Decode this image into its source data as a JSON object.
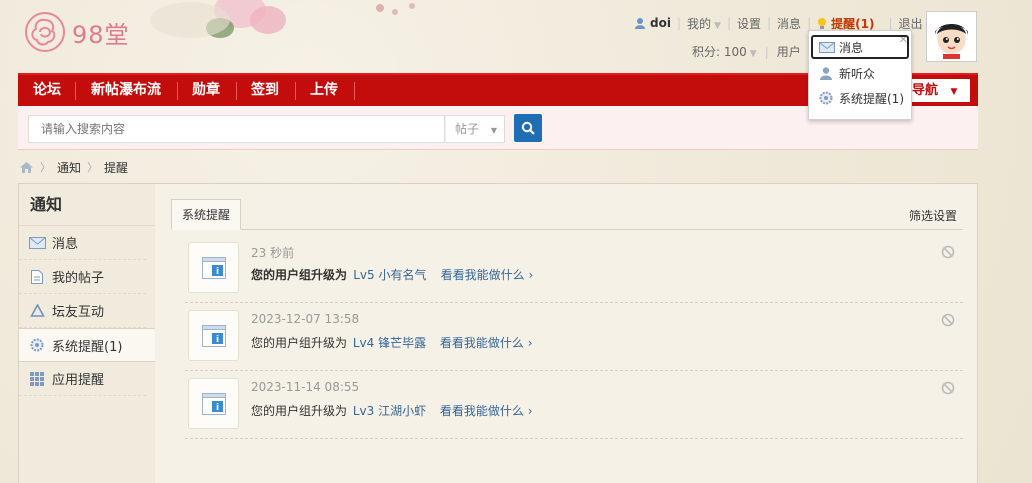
{
  "site": {
    "logo_text": "98堂"
  },
  "userbar": {
    "username": "doi",
    "my": "我的",
    "settings": "设置",
    "messages": "消息",
    "remind": "提醒(1)",
    "logout": "退出",
    "points": "积分: 100",
    "user_group": "用户"
  },
  "nav": {
    "items": [
      "论坛",
      "新帖瀑布流",
      "勋章",
      "签到",
      "上传"
    ],
    "quick": "导航"
  },
  "search": {
    "placeholder": "请输入搜索内容",
    "type": "帖子"
  },
  "breadcrumb": [
    "通知",
    "提醒"
  ],
  "sidebar": {
    "title": "通知",
    "items": [
      {
        "label": "消息",
        "icon": "mail-icon"
      },
      {
        "label": "我的帖子",
        "icon": "document-icon"
      },
      {
        "label": "坛友互动",
        "icon": "recycle-icon"
      },
      {
        "label": "系统提醒(1)",
        "icon": "gear-icon"
      },
      {
        "label": "应用提醒",
        "icon": "grid-icon"
      }
    ]
  },
  "main": {
    "tab": "系统提醒",
    "filter": "筛选设置",
    "notices": [
      {
        "time": "23 秒前",
        "prefix": "您的用户组升级为",
        "level": "Lv5 小有名气",
        "link": "看看我能做什么 ›",
        "unread": true
      },
      {
        "time": "2023-12-07 13:58",
        "prefix": "您的用户组升级为",
        "level": "Lv4 锋芒毕露",
        "link": "看看我能做什么 ›",
        "unread": false
      },
      {
        "time": "2023-11-14 08:55",
        "prefix": "您的用户组升级为",
        "level": "Lv3 江湖小虾",
        "link": "看看我能做什么 ›",
        "unread": false
      }
    ]
  },
  "dropdown": {
    "items": [
      {
        "label": "消息",
        "icon": "mail-icon"
      },
      {
        "label": "新听众",
        "icon": "user-icon"
      },
      {
        "label": "系统提醒(1)",
        "icon": "gear-icon"
      }
    ]
  },
  "colors": {
    "nav_red": "#c30d0d",
    "link_blue": "#336699",
    "search_blue": "#1f6eb4"
  }
}
